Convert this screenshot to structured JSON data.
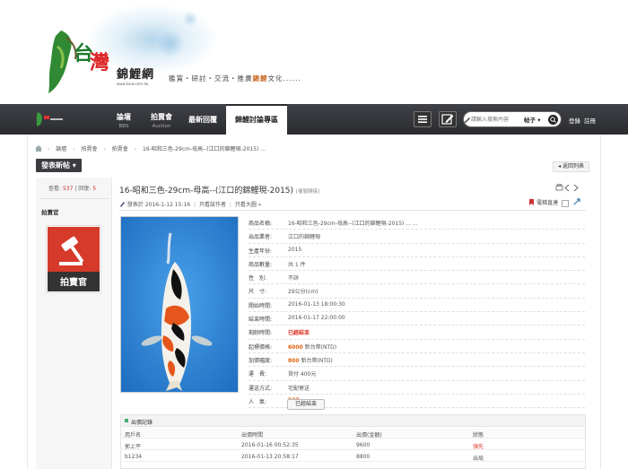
{
  "banner": {
    "logo_char_1": "台",
    "logo_char_2": "灣",
    "site_name": "錦鯉網",
    "site_url": "www.koiw.com.tw",
    "slogan_pre": "鑑賞・研討・交流・推廣",
    "slogan_hl": "錦鯉",
    "slogan_post": "文化......"
  },
  "nav": {
    "items": [
      {
        "main": "論壇",
        "sub": "BBS"
      },
      {
        "main": "拍賣會",
        "sub": "Auction"
      },
      {
        "main": "最新回覆",
        "sub": ""
      },
      {
        "main": "錦鯉討論專區",
        "sub": ""
      }
    ],
    "search_placeholder": "請輸入搜索內容",
    "search_type": "帖子 ▾",
    "login": "登錄",
    "register": "註冊"
  },
  "breadcrumb": [
    "論壇",
    "拍賣會",
    "拍賣會",
    "16-昭和三色-29cm-母高--(江口的錦鯉現-2015) ..."
  ],
  "breadcrumb_sep": "›",
  "post_button": "發表新帖 ▾",
  "back_button": "◂ 返回列表",
  "stats": {
    "views_label": "查看:",
    "views": "537",
    "sep": "|",
    "replies_label": "回復:",
    "replies": "5"
  },
  "author": "拍賣官",
  "avatar_text": "拍賣官",
  "post": {
    "title": "16-昭和三色-29cm-母高--(江口的錦鯉現-2015)",
    "title_tag": "[複製鏈接]",
    "meta_posted": "發表於 2016-1-12 15:16",
    "meta_only_author": "只看該作者",
    "meta_only_big": "只看大圖",
    "meta_more": "»",
    "meta_right": "電梯直達"
  },
  "details": [
    {
      "label": "商品名稱:",
      "value": "16-昭和三色-29cm-母高--(江口的錦鯉現-2015) ... ...",
      "style": ""
    },
    {
      "label": "出品業者:",
      "value": "江口的錦鯉現",
      "style": ""
    },
    {
      "label": "生產年份:",
      "value": "2015",
      "style": ""
    },
    {
      "label": "商品數量:",
      "value": "共 1 件",
      "style": ""
    },
    {
      "label": "性　別:",
      "value": "不詳",
      "style": ""
    },
    {
      "label": "尺　寸:",
      "value": "29公分(cm)",
      "style": ""
    },
    {
      "label": "開始時間:",
      "value": "2016-01-13 18:00:30",
      "style": ""
    },
    {
      "label": "結束時間:",
      "value": "2016-01-17 22:00:00",
      "style": ""
    },
    {
      "label": "剩餘時間:",
      "value": "已經結束",
      "style": "red"
    },
    {
      "label": "起標價格:",
      "value": "6000",
      "suffix": " 新台幣(NTD)",
      "style": "orange"
    },
    {
      "label": "加價幅度:",
      "value": "800",
      "suffix": " 新台幣(NTD)",
      "style": "orange"
    },
    {
      "label": "運　費:",
      "value": "貨付 400元",
      "style": ""
    },
    {
      "label": "運送方式:",
      "value": "宅配寄送",
      "style": ""
    },
    {
      "label": "人　氣:",
      "value": "537",
      "style": "orange"
    }
  ],
  "closed_button": "已經結束",
  "bids": {
    "title": "出價記錄",
    "headers": [
      "用戶名",
      "出價時間",
      "出價(金額)",
      "狀態"
    ],
    "rows": [
      {
        "user": "郭上平",
        "time": "2016-01-16 00:52:35",
        "amount": "9600",
        "status": "領先",
        "status_red": true
      },
      {
        "user": "b1234",
        "time": "2016-01-13 20:58:17",
        "amount": "8800",
        "status": "出局",
        "status_red": false
      }
    ]
  },
  "colors": {
    "nav_bg": "#2b2c30",
    "accent_red": "#d32",
    "price_orange": "#e06010",
    "koi_bg": "#2f7fd0"
  }
}
